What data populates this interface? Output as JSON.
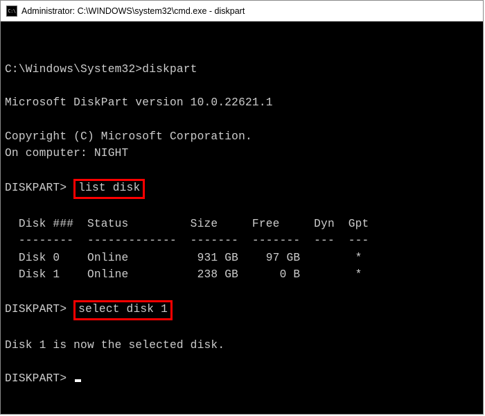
{
  "titlebar": {
    "icon_label": "C:\\",
    "title": "Administrator: C:\\WINDOWS\\system32\\cmd.exe - diskpart"
  },
  "lines": {
    "cmd_prompt": "C:\\Windows\\System32>",
    "cmd_command": "diskpart",
    "version": "Microsoft DiskPart version 10.0.22621.1",
    "copyright": "Copyright (C) Microsoft Corporation.",
    "computer": "On computer: NIGHT",
    "dp_prompt1": "DISKPART> ",
    "cmd_list": "list disk",
    "table_header": "  Disk ###  Status         Size     Free     Dyn  Gpt",
    "table_divider": "  --------  -------------  -------  -------  ---  ---",
    "table_row0": "  Disk 0    Online          931 GB    97 GB        *",
    "table_row1": "  Disk 1    Online          238 GB      0 B        *",
    "dp_prompt2": "DISKPART> ",
    "cmd_select": "select disk 1",
    "selected": "Disk 1 is now the selected disk.",
    "dp_prompt3": "DISKPART> "
  },
  "disks": [
    {
      "id": "Disk 0",
      "status": "Online",
      "size": "931 GB",
      "free": "97 GB",
      "dyn": "",
      "gpt": "*"
    },
    {
      "id": "Disk 1",
      "status": "Online",
      "size": "238 GB",
      "free": "0 B",
      "dyn": "",
      "gpt": "*"
    }
  ]
}
